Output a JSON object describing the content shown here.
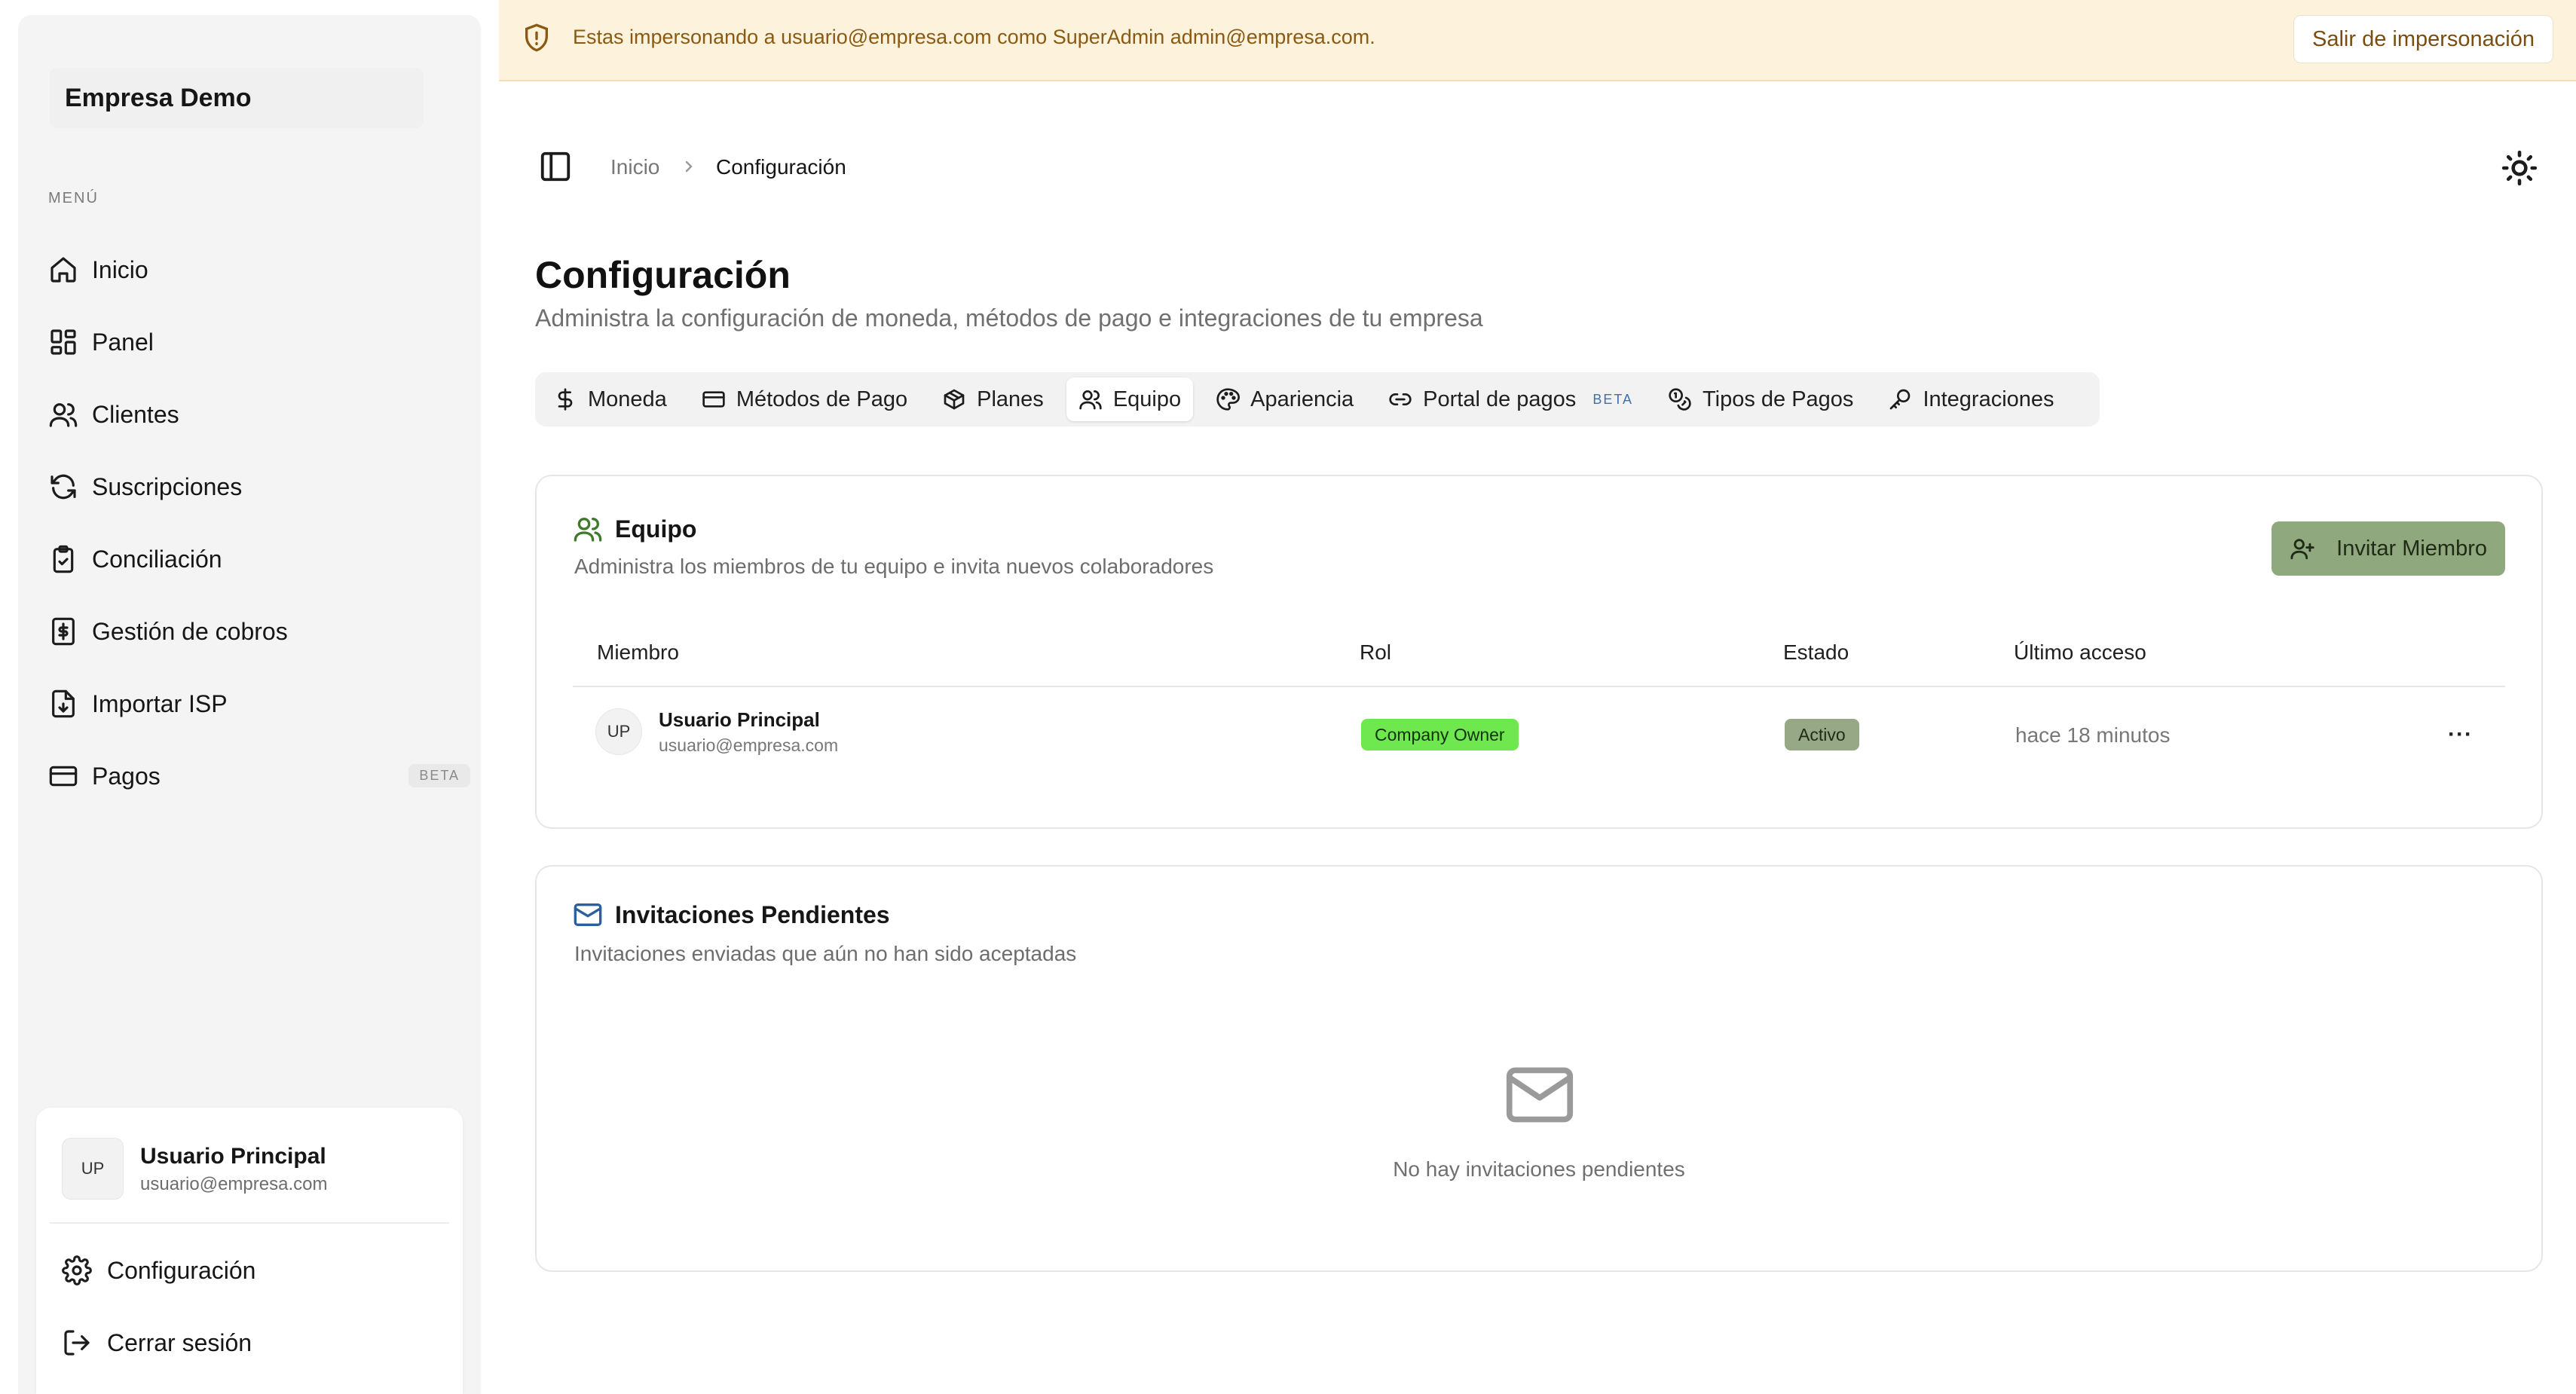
{
  "sidebar": {
    "brand": "Empresa Demo",
    "menu_label": "MENÚ",
    "items": [
      {
        "label": "Inicio",
        "icon": "home-icon"
      },
      {
        "label": "Panel",
        "icon": "dashboard-icon"
      },
      {
        "label": "Clientes",
        "icon": "users-icon"
      },
      {
        "label": "Suscripciones",
        "icon": "refresh-icon"
      },
      {
        "label": "Conciliación",
        "icon": "clipboard-check-icon"
      },
      {
        "label": "Gestión de cobros",
        "icon": "dollar-receipt-icon"
      },
      {
        "label": "Importar ISP",
        "icon": "file-import-icon"
      },
      {
        "label": "Pagos",
        "icon": "credit-card-icon",
        "badge": "BETA"
      }
    ],
    "user": {
      "initials": "UP",
      "name": "Usuario Principal",
      "email": "usuario@empresa.com"
    },
    "actions": {
      "settings": "Configuración",
      "logout": "Cerrar sesión"
    }
  },
  "banner": {
    "text": "Estas impersonando a usuario@empresa.com como SuperAdmin admin@empresa.com.",
    "exit_label": "Salir de impersonación",
    "color": "#8a5a14",
    "background": "#fdf2dc"
  },
  "breadcrumb": {
    "home": "Inicio",
    "current": "Configuración"
  },
  "page": {
    "title": "Configuración",
    "subtitle": "Administra la configuración de moneda, métodos de pago e integraciones de tu empresa"
  },
  "tabs": [
    {
      "label": "Moneda",
      "icon": "dollar-icon"
    },
    {
      "label": "Métodos de Pago",
      "icon": "credit-card-icon"
    },
    {
      "label": "Planes",
      "icon": "box-icon"
    },
    {
      "label": "Equipo",
      "icon": "users-icon",
      "active": true
    },
    {
      "label": "Apariencia",
      "icon": "palette-icon"
    },
    {
      "label": "Portal de pagos",
      "icon": "link-icon",
      "badge": "BETA"
    },
    {
      "label": "Tipos de Pagos",
      "icon": "coins-icon"
    },
    {
      "label": "Integraciones",
      "icon": "key-icon"
    }
  ],
  "team": {
    "title": "Equipo",
    "description": "Administra los miembros de tu equipo e invita nuevos colaboradores",
    "invite_label": "Invitar Miembro",
    "columns": [
      "Miembro",
      "Rol",
      "Estado",
      "Último acceso"
    ],
    "rows": [
      {
        "initials": "UP",
        "name": "Usuario Principal",
        "email": "usuario@empresa.com",
        "role": "Company Owner",
        "status": "Activo",
        "last_access": "hace 18 minutos",
        "more": "···"
      }
    ],
    "accent": "#8fa87d",
    "role_color": "#6fe84f"
  },
  "invitations": {
    "title": "Invitaciones Pendientes",
    "description": "Invitaciones enviadas que aún no han sido aceptadas",
    "empty_text": "No hay invitaciones pendientes",
    "icon": "mail-icon"
  }
}
